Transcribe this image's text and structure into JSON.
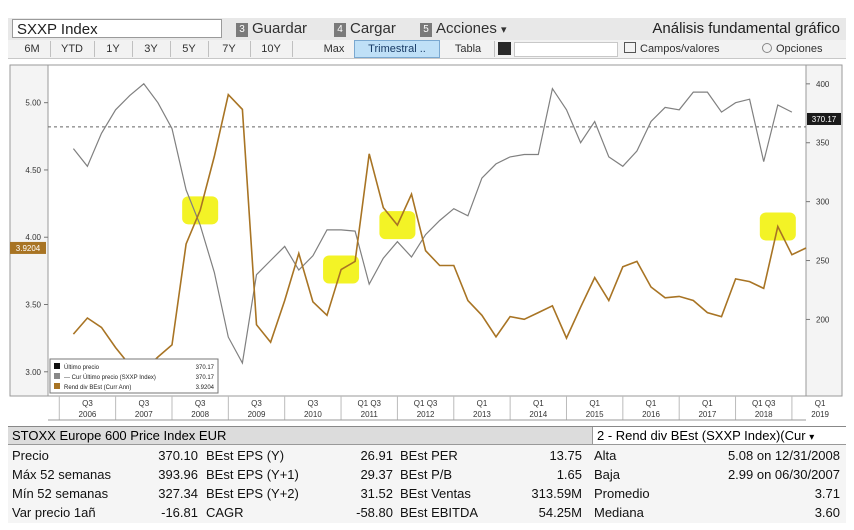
{
  "toolbar": {
    "ticker": "SXXP Index",
    "buttons": [
      {
        "num": "3",
        "label": "Guardar"
      },
      {
        "num": "4",
        "label": "Cargar"
      },
      {
        "num": "5",
        "label": "Acciones"
      }
    ],
    "acciones_caret": "▾",
    "title": "Análisis fundamental gráfico"
  },
  "ranges": {
    "buttons": [
      "6M",
      "YTD",
      "1Y",
      "3Y",
      "5Y",
      "7Y",
      "10Y",
      "Max",
      "Trimestral ..",
      "Tabla"
    ],
    "active": "Trimestral ..",
    "campos": "Campos/valores",
    "opciones": "Opciones"
  },
  "chart_data": {
    "type": "line",
    "x_start": 2006.25,
    "x_step": 0.25,
    "xlim": [
      2005.8,
      2019.25
    ],
    "left_axis": {
      "ylim": [
        2.82,
        5.28
      ],
      "ticks": [
        3.0,
        3.5,
        4.0,
        4.5,
        5.0
      ],
      "tick_labels": [
        "3.00",
        "3.50",
        "4.00",
        "4.50",
        "5.00"
      ]
    },
    "right_axis": {
      "ylim": [
        135,
        416
      ],
      "ticks": [
        200,
        250,
        300,
        350,
        400
      ],
      "tick_labels": [
        "200",
        "250",
        "300",
        "350",
        "400"
      ]
    },
    "x_tick_labels": [
      {
        "x": 2006.0,
        "q": "Q3",
        "year": "2006"
      },
      {
        "x": 2007.0,
        "q": "Q3",
        "year": "2007"
      },
      {
        "x": 2008.0,
        "q": "Q3",
        "year": "2008"
      },
      {
        "x": 2009.0,
        "q": "Q3",
        "year": "2009"
      },
      {
        "x": 2010.0,
        "q": "Q3",
        "year": "2010"
      },
      {
        "x": 2011.0,
        "q": "Q1 Q3",
        "year": "2011"
      },
      {
        "x": 2012.0,
        "q": "Q1 Q3",
        "year": "2012"
      },
      {
        "x": 2013.0,
        "q": "Q1",
        "year": "2013"
      },
      {
        "x": 2014.0,
        "q": "Q1",
        "year": "2014"
      },
      {
        "x": 2015.0,
        "q": "Q1",
        "year": "2015"
      },
      {
        "x": 2016.0,
        "q": "Q1",
        "year": "2016"
      },
      {
        "x": 2017.0,
        "q": "Q1",
        "year": "2017"
      },
      {
        "x": 2018.0,
        "q": "Q1 Q3",
        "year": "2018"
      },
      {
        "x": 2019.0,
        "q": "Q1",
        "year": "2019"
      }
    ],
    "series": [
      {
        "name": "Último precio",
        "axis": "right",
        "color": "#808080",
        "values": [
          345,
          330,
          358,
          378,
          390,
          400,
          384,
          362,
          310,
          280,
          240,
          185,
          163,
          238,
          250,
          262,
          242,
          254,
          276,
          276,
          275,
          230,
          252,
          266,
          253,
          272,
          284,
          294,
          288,
          320,
          332,
          338,
          340,
          340,
          396,
          378,
          350,
          368,
          338,
          330,
          343,
          368,
          380,
          378,
          393,
          393,
          376,
          384,
          387,
          334,
          382,
          376
        ]
      },
      {
        "name": "Rend div BEst (Curr Ann)",
        "axis": "left",
        "color": "#a87424",
        "values": [
          3.28,
          3.4,
          3.33,
          3.18,
          3.05,
          3.01,
          3.11,
          3.2,
          3.95,
          4.2,
          4.6,
          5.06,
          4.95,
          3.35,
          3.22,
          3.53,
          3.88,
          3.52,
          3.42,
          3.76,
          3.82,
          4.62,
          4.22,
          4.09,
          4.32,
          3.9,
          3.79,
          3.79,
          3.53,
          3.42,
          3.26,
          3.41,
          3.39,
          3.44,
          3.49,
          3.25,
          3.48,
          3.7,
          3.53,
          3.78,
          3.82,
          3.63,
          3.55,
          3.56,
          3.53,
          3.44,
          3.41,
          3.69,
          3.67,
          3.62,
          4.08,
          3.87,
          3.92
        ]
      }
    ],
    "ref_line_left": 4.82,
    "right_tag": "370.17",
    "left_tag": "3.9204",
    "highlight_centers": [
      2008.5,
      2011.0,
      2012.0,
      2018.75
    ],
    "highlight_color": "#f2f21a",
    "legend": {
      "entries": [
        {
          "swatch": "#111111",
          "label": "Último precio",
          "value": "370.17"
        },
        {
          "swatch": "#888888",
          "label": "--- Cur Último precio (SXXP Index)",
          "value": "370.17"
        },
        {
          "swatch": "#a87424",
          "label": "Rend div BEst (Curr Ann)",
          "value": "3.9204"
        }
      ]
    }
  },
  "table": {
    "header_left": "STOXX Europe 600 Price Index EUR",
    "header_right": "2 - Rend div BEst (SXXP Index)(Cur",
    "header_caret": "▾",
    "rows": [
      [
        "Precio",
        "370.10",
        "BEst EPS (Y)",
        "26.91",
        "BEst PER",
        "13.75",
        "Alta",
        "5.08 on 12/31/2008"
      ],
      [
        "Máx 52 semanas",
        "393.96",
        "BEst EPS (Y+1)",
        "29.37",
        "BEst P/B",
        "1.65",
        "Baja",
        "2.99 on 06/30/2007"
      ],
      [
        "Mín 52 semanas",
        "327.34",
        "BEst EPS (Y+2)",
        "31.52",
        "BEst Ventas",
        "313.59M",
        "Promedio",
        "3.71"
      ],
      [
        "Var precio 1añ",
        "-16.81",
        "CAGR",
        "-58.80",
        "BEst EBITDA",
        "54.25M",
        "Mediana",
        "3.60"
      ]
    ]
  }
}
